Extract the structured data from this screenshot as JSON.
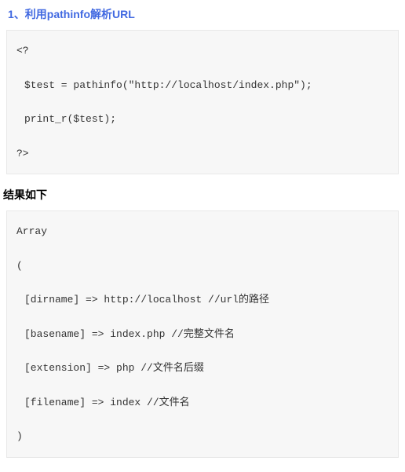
{
  "heading": "1、利用pathinfo解析URL",
  "code1": {
    "l1": "<?",
    "l2": "$test = pathinfo(\"http://localhost/index.php\");",
    "l3": "print_r($test);",
    "l4": "?>"
  },
  "subheading": "结果如下",
  "code2": {
    "l1": "Array",
    "l2": "(",
    "l3": "[dirname] => http://localhost //url的路径",
    "l4": "[basename] => index.php //完整文件名",
    "l5": "[extension] => php //文件名后缀",
    "l6": "[filename] => index //文件名",
    "l7": ")"
  }
}
